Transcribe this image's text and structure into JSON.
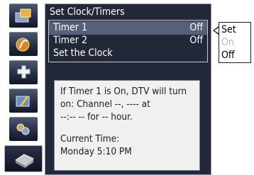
{
  "sidebar": {
    "items": [
      {
        "icon": "picture-icon"
      },
      {
        "icon": "audio-icon"
      },
      {
        "icon": "setup-icon"
      },
      {
        "icon": "channel-icon"
      },
      {
        "icon": "locks-icon"
      },
      {
        "icon": "timer-icon",
        "active": true
      }
    ]
  },
  "panel": {
    "title": "Set Clock/Timers",
    "items": [
      {
        "label": "Timer 1",
        "value": "Off"
      },
      {
        "label": "Timer 2",
        "value": "Off"
      },
      {
        "label": "Set the Clock",
        "value": ""
      }
    ],
    "info": {
      "line1": "If Timer 1 is On, DTV will turn\non: Channel --, ---- at\n--:-- -- for -- hour.",
      "line2": "Current Time:\nMonday 5:10 PM"
    }
  },
  "popup": {
    "options": [
      {
        "label": "Set",
        "enabled": true
      },
      {
        "label": "On",
        "enabled": false
      },
      {
        "label": "Off",
        "enabled": true
      }
    ]
  }
}
